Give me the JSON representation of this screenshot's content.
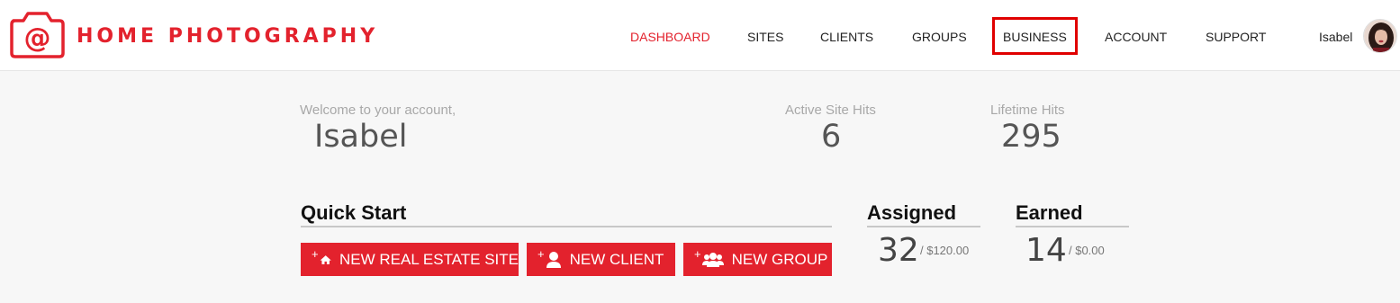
{
  "brand": {
    "name": "HOME PHOTOGRAPHY",
    "color": "#e3222d"
  },
  "nav": {
    "items": [
      {
        "label": "DASHBOARD",
        "active": true
      },
      {
        "label": "SITES",
        "active": false
      },
      {
        "label": "CLIENTS",
        "active": false
      },
      {
        "label": "GROUPS",
        "active": false
      },
      {
        "label": "BUSINESS",
        "active": false,
        "highlighted": true
      },
      {
        "label": "ACCOUNT",
        "active": false
      },
      {
        "label": "SUPPORT",
        "active": false
      }
    ],
    "user": {
      "name": "Isabel",
      "avatar_icon": "user-photo"
    }
  },
  "welcome": {
    "label": "Welcome to your account,",
    "name": "Isabel"
  },
  "stats": {
    "active_site_hits": {
      "label": "Active Site Hits",
      "value": "6"
    },
    "lifetime_hits": {
      "label": "Lifetime Hits",
      "value": "295"
    }
  },
  "quick_start": {
    "title": "Quick Start",
    "buttons": [
      {
        "label": "NEW REAL ESTATE SITE",
        "icon": "home-icon"
      },
      {
        "label": "NEW CLIENT",
        "icon": "user-icon"
      },
      {
        "label": "NEW GROUP",
        "icon": "group-icon"
      }
    ]
  },
  "assigned": {
    "title": "Assigned",
    "count": "32",
    "amount": "/ $120.00"
  },
  "earned": {
    "title": "Earned",
    "count": "14",
    "amount": "/ $0.00"
  },
  "colors": {
    "accent": "#e3222d",
    "highlight_box": "#e00000"
  }
}
